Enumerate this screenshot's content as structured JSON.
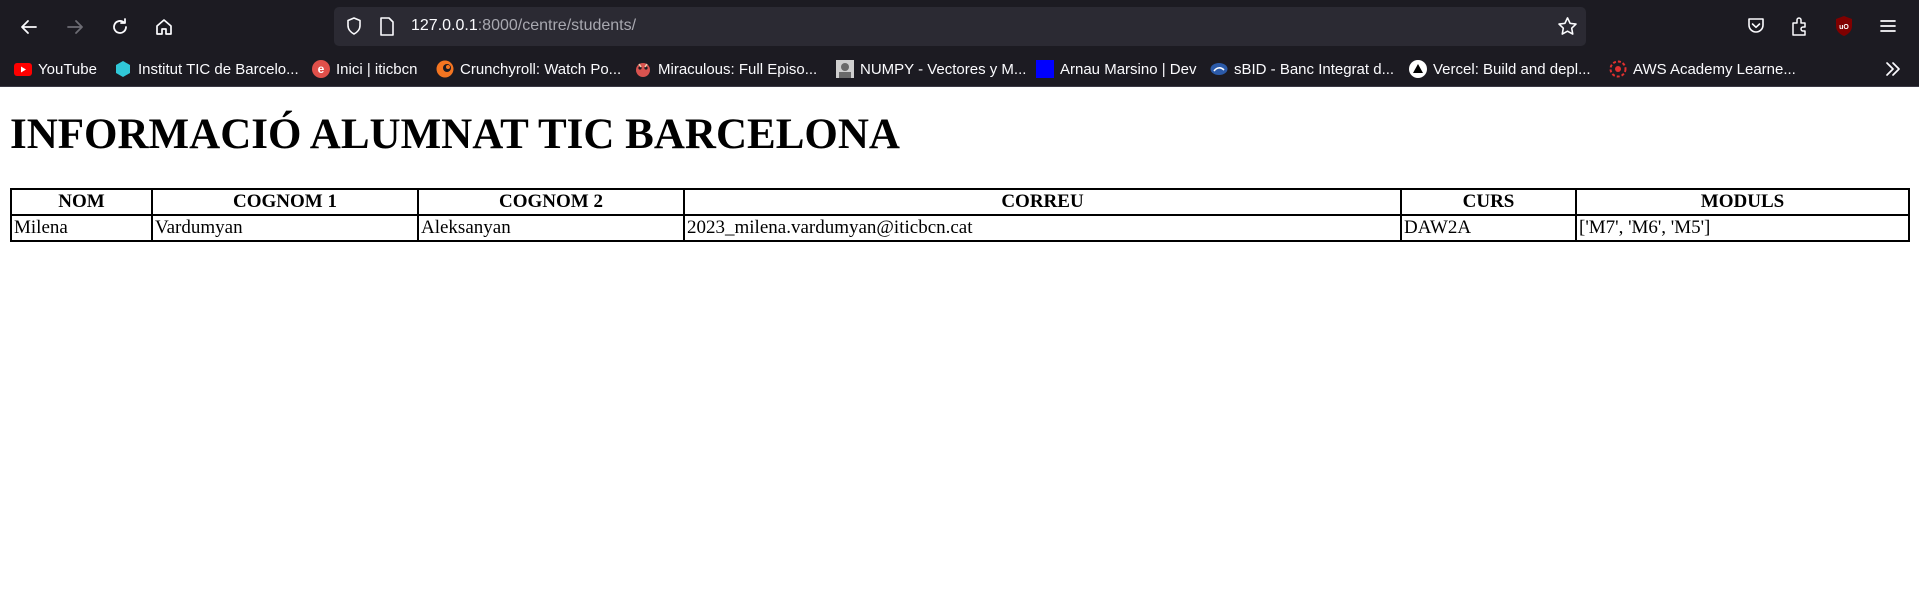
{
  "browser": {
    "url_host": "127.0.0.1",
    "url_rest": ":8000/centre/students/",
    "bookmarks": [
      {
        "label": "YouTube",
        "icon": "youtube-icon",
        "color": "#ff0000"
      },
      {
        "label": "Institut TIC de Barcelo...",
        "icon": "institut-tic-icon",
        "color": "#30c8d8"
      },
      {
        "label": "Inici | iticbcn",
        "icon": "iticbcn-icon",
        "color": "#e0504a"
      },
      {
        "label": "Crunchyroll: Watch Po...",
        "icon": "crunchyroll-icon",
        "color": "#f47521"
      },
      {
        "label": "Miraculous: Full Episo...",
        "icon": "miraculous-icon",
        "color": "#d9534f"
      },
      {
        "label": "NUMPY - Vectores y M...",
        "icon": "numpy-icon",
        "color": "#8a8a8a"
      },
      {
        "label": "Arnau Marsino | Dev",
        "icon": "arnau-icon",
        "color": "#0000ff"
      },
      {
        "label": "sBID - Banc Integrat d...",
        "icon": "sbid-icon",
        "color": "#2b5aa8"
      },
      {
        "label": "Vercel: Build and depl...",
        "icon": "vercel-icon",
        "color": "#000000"
      },
      {
        "label": "AWS Academy Learne...",
        "icon": "aws-academy-icon",
        "color": "#e0302f"
      }
    ]
  },
  "page": {
    "title": "INFORMACIÓ ALUMNAT TIC BARCELONA",
    "table": {
      "headers": [
        "NOM",
        "COGNOM 1",
        "COGNOM 2",
        "CORREU",
        "CURS",
        "MODULS"
      ],
      "rows": [
        [
          "Milena",
          "Vardumyan",
          "Aleksanyan",
          "2023_milena.vardumyan@iticbcn.cat",
          "DAW2A",
          "['M7', 'M6', 'M5']"
        ]
      ]
    }
  }
}
